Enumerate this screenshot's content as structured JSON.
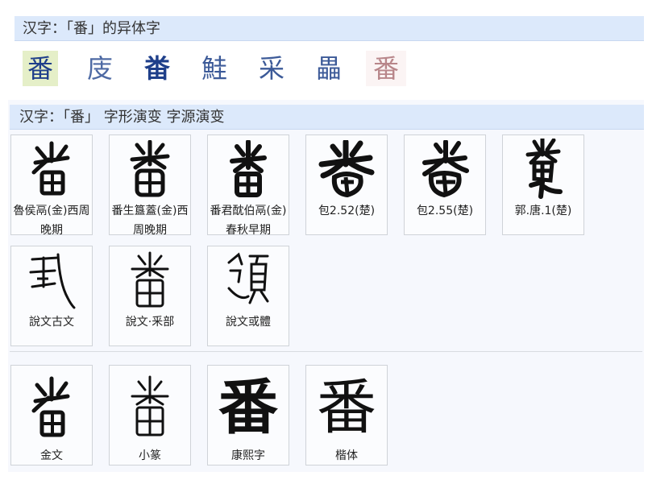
{
  "variants_section": {
    "title": "汉字：「番」的异体字",
    "variants": [
      {
        "char": "番",
        "selected": true
      },
      {
        "char": "庋",
        "selected": false
      },
      {
        "char": "畨",
        "selected": false
      },
      {
        "char": "鮭",
        "selected": false
      },
      {
        "char": "采",
        "selected": false
      },
      {
        "char": "畾",
        "selected": false
      },
      {
        "char": "番",
        "selected": false
      }
    ]
  },
  "evolution_section": {
    "title": "汉字：「番」 字形演变 字源演变",
    "row1": [
      {
        "label": "魯侯鬲(金)西周晚期",
        "glyph_icon": "bronze-inscription-glyph"
      },
      {
        "label": "番生簋蓋(金)西周晚期",
        "glyph_icon": "bronze-inscription-glyph"
      },
      {
        "label": "番君酖伯鬲(金)春秋早期",
        "glyph_icon": "bronze-inscription-glyph"
      },
      {
        "label": "包2.52(楚)",
        "glyph_icon": "chu-bamboo-glyph"
      },
      {
        "label": "包2.55(楚)",
        "glyph_icon": "chu-bamboo-glyph"
      },
      {
        "label": "郭.唐.1(楚)",
        "glyph_icon": "chu-bamboo-glyph"
      }
    ],
    "row2": [
      {
        "label": "說文古文",
        "glyph_icon": "shuowen-ancient-glyph"
      },
      {
        "label": "說文·釆部",
        "glyph_icon": "shuowen-seal-glyph"
      },
      {
        "label": "說文或體",
        "glyph_icon": "shuowen-variant-glyph"
      }
    ],
    "row3": [
      {
        "label": "金文",
        "glyph_icon": "bronze-script-glyph"
      },
      {
        "label": "小篆",
        "glyph_icon": "small-seal-glyph"
      },
      {
        "label": "康熙字",
        "glyph": "番"
      },
      {
        "label": "楷体",
        "glyph": "番"
      }
    ]
  }
}
